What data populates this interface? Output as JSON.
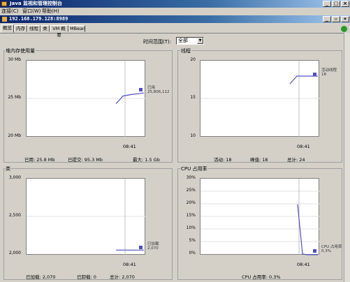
{
  "window": {
    "title": "Java 监视和管理控制台"
  },
  "menu": [
    "连接(C)",
    "窗口(W)",
    "帮助(H)"
  ],
  "connection": {
    "title": "192.168.179.128:8989"
  },
  "tabs": [
    "概览",
    "内存",
    "线程",
    "类",
    "VM 概要",
    "MBean"
  ],
  "time_range": {
    "label": "时间范围(T):",
    "value": "全部"
  },
  "heap": {
    "title": "堆内存使用量",
    "yticks": [
      "30 Mb",
      "25 Mb",
      "20 Mb"
    ],
    "xtick": "08:41",
    "legend_label": "已用",
    "legend_value": "25,806,112",
    "stats": {
      "used": "已用: 25.8 Mb",
      "committed": "已提交: 95.3 Mb",
      "max": "最大: 1.5 Gb"
    }
  },
  "threads": {
    "title": "线程",
    "yticks": [
      "20",
      "15",
      "10"
    ],
    "xtick": "08:41",
    "legend_label": "活动线程",
    "legend_value": "18",
    "stats": {
      "live": "活动: 18",
      "peak": "峰值: 18",
      "total": "总计: 24"
    }
  },
  "classes": {
    "title": "类",
    "yticks": [
      "3,000",
      "2,500",
      "2,000"
    ],
    "xtick": "08:41",
    "legend_label": "已加载",
    "legend_value": "2,070",
    "stats": {
      "loaded": "已加载: 2,070",
      "unloaded": "已卸载: 0",
      "total": "总计: 2,070"
    }
  },
  "cpu": {
    "title": "CPU 占用率",
    "yticks": [
      "30%",
      "25%",
      "20%",
      "15%",
      "10%",
      "5%",
      "0%"
    ],
    "xtick": "08:41",
    "legend_label": "CPU 占用率",
    "legend_value": "0.3%",
    "stats": {
      "usage": "CPU 占用率: 0.3%"
    }
  },
  "chart_data": [
    {
      "type": "line",
      "title": "堆内存使用量",
      "ylabel": "Mb",
      "ylim": [
        20,
        30
      ],
      "x": [
        "",
        "",
        "08:41",
        ""
      ],
      "series": [
        {
          "name": "已用",
          "values": [
            24.4,
            25.4,
            25.6,
            25.8
          ]
        }
      ]
    },
    {
      "type": "line",
      "title": "线程",
      "ylim": [
        10,
        20
      ],
      "x": [
        "",
        "",
        "08:41",
        ""
      ],
      "series": [
        {
          "name": "活动线程",
          "values": [
            17,
            18,
            18,
            18
          ]
        }
      ]
    },
    {
      "type": "line",
      "title": "类",
      "ylim": [
        2000,
        3000
      ],
      "x": [
        "",
        "08:41",
        ""
      ],
      "series": [
        {
          "name": "已加载",
          "values": [
            2070,
            2070,
            2070
          ]
        }
      ]
    },
    {
      "type": "line",
      "title": "CPU 占用率",
      "ylabel": "%",
      "ylim": [
        0,
        30
      ],
      "x": [
        "",
        "",
        "08:41",
        ""
      ],
      "series": [
        {
          "name": "CPU 占用率",
          "values": [
            20,
            0.6,
            0.3,
            0.3
          ]
        }
      ]
    }
  ]
}
